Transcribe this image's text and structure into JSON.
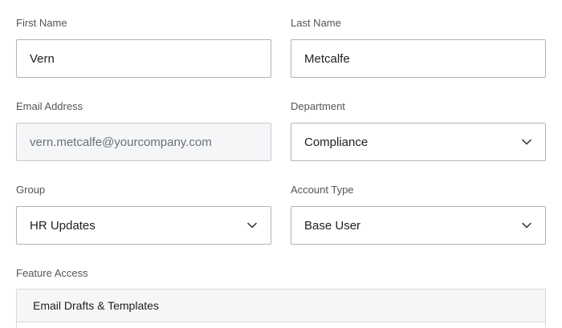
{
  "form": {
    "first_name": {
      "label": "First Name",
      "value": "Vern"
    },
    "last_name": {
      "label": "Last Name",
      "value": "Metcalfe"
    },
    "email": {
      "label": "Email Address",
      "value": "vern.metcalfe@yourcompany.com"
    },
    "department": {
      "label": "Department",
      "value": "Compliance"
    },
    "group": {
      "label": "Group",
      "value": "HR Updates"
    },
    "account_type": {
      "label": "Account Type",
      "value": "Base User"
    },
    "feature_access": {
      "label": "Feature Access",
      "items": [
        {
          "label": "Email Drafts & Templates"
        }
      ]
    }
  },
  "icons": {
    "dropdown": "chevron-down-icon"
  },
  "colors": {
    "border": "#b3b3b3",
    "readonly_bg": "#f5f6f8",
    "label": "#555555"
  }
}
